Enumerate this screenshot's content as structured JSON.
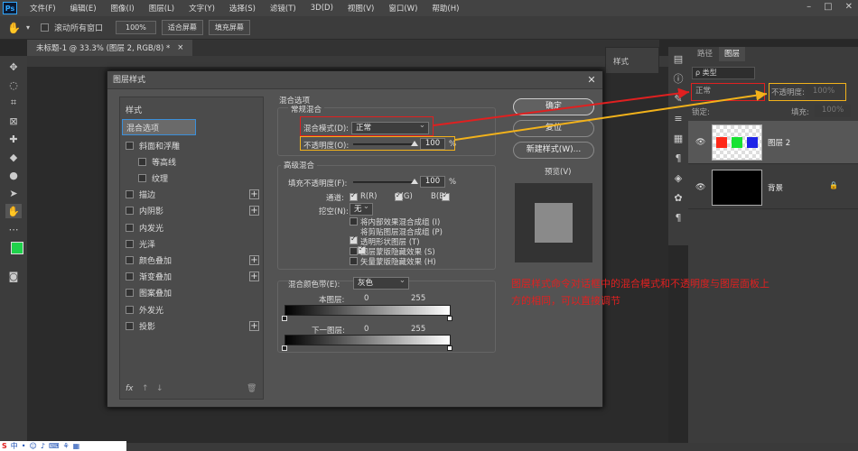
{
  "app": {
    "logo": "Ps"
  },
  "menu": [
    "文件(F)",
    "编辑(E)",
    "图像(I)",
    "图层(L)",
    "文字(Y)",
    "选择(S)",
    "滤镜(T)",
    "3D(D)",
    "视图(V)",
    "窗口(W)",
    "帮助(H)"
  ],
  "window_controls": [
    "–",
    "□",
    "✕"
  ],
  "options": {
    "scroll_all_label": "滚动所有窗口",
    "zoom_value": "100%",
    "fit_screen": "适合屏幕",
    "fill_screen": "填充屏幕"
  },
  "document_tab": {
    "title": "未标题-1 @ 33.3% (图层 2, RGB/8) *",
    "close": "×"
  },
  "dialog": {
    "title": "图层样式",
    "close": "✕",
    "styles_header": "样式",
    "selected": "混合选项",
    "items": [
      {
        "label": "斜面和浮雕",
        "checked": false,
        "plus": false
      },
      {
        "label": "等高线",
        "checked": false,
        "plus": false,
        "indent": true
      },
      {
        "label": "纹理",
        "checked": false,
        "plus": false,
        "indent": true
      },
      {
        "label": "描边",
        "checked": false,
        "plus": true
      },
      {
        "label": "内阴影",
        "checked": false,
        "plus": true
      },
      {
        "label": "内发光",
        "checked": false,
        "plus": false
      },
      {
        "label": "光泽",
        "checked": false,
        "plus": false
      },
      {
        "label": "颜色叠加",
        "checked": false,
        "plus": true
      },
      {
        "label": "渐变叠加",
        "checked": false,
        "plus": true
      },
      {
        "label": "图案叠加",
        "checked": false,
        "plus": false
      },
      {
        "label": "外发光",
        "checked": false,
        "plus": false
      },
      {
        "label": "投影",
        "checked": false,
        "plus": true
      }
    ],
    "footer_fx": "fx",
    "blend_options": {
      "section_title": "混合选项",
      "general_title": "常规混合",
      "blend_mode_label": "混合模式(D):",
      "blend_mode_value": "正常",
      "opacity_label": "不透明度(O):",
      "opacity_value": "100",
      "percent": "%",
      "opacity_level": 1.0
    },
    "advanced": {
      "title": "高级混合",
      "fill_opacity_label": "填充不透明度(F):",
      "fill_opacity_value": "100",
      "fill_level": 1.0,
      "channels_label": "通道:",
      "channels": [
        "R(R)",
        "G(G)",
        "B(B)"
      ],
      "knockout_label": "挖空(N):",
      "knockout_value": "无",
      "options": [
        {
          "label": "将内部效果混合成组 (I)",
          "checked": false
        },
        {
          "label": "将剪贴图层混合成组 (P)",
          "checked": true
        },
        {
          "label": "透明形状图层 (T)",
          "checked": true
        },
        {
          "label": "图层蒙版隐藏效果 (S)",
          "checked": false
        },
        {
          "label": "矢量蒙版隐藏效果 (H)",
          "checked": false
        }
      ]
    },
    "blend_if": {
      "label": "混合颜色带(E):",
      "value": "灰色",
      "this_layer": "本图层:",
      "underlying": "下一图层:",
      "min": "0",
      "max": "255"
    },
    "buttons": {
      "ok": "确定",
      "reset": "复位",
      "new_style": "新建样式(W)...",
      "preview_label": "预览(V)"
    }
  },
  "mini_panel": {
    "label": "样式"
  },
  "layers_panel": {
    "tabs": [
      "路径",
      "图层"
    ],
    "kind_label": "ρ 类型",
    "blend_mode": "正常",
    "opacity_label": "不透明度:",
    "opacity_value": "100%",
    "lock_label": "锁定:",
    "fill_label": "填充:",
    "fill_value": "100%",
    "layers": [
      {
        "name": "图层 2"
      },
      {
        "name": "背景",
        "lock": "🔒"
      }
    ]
  },
  "annotation": "图层样式命令对话框中的混合模式和不透明度与图层面板上方的相同，可以直接调节",
  "colors": {
    "annot_red": "#e02020",
    "annot_yellow": "#f2b21b",
    "fg_color": "#1fd24b",
    "bg_color": "#ff1a1a",
    "selection_border": "#3b8fd9"
  }
}
